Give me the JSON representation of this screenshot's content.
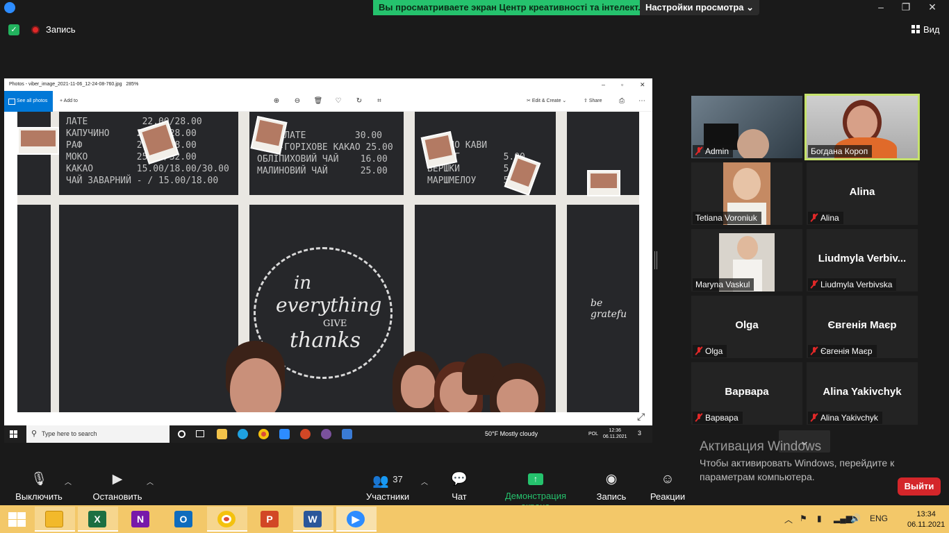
{
  "zoom": {
    "share_banner": "Вы просматриваете экран Центр креативності та інтелект...",
    "view_options": "Настройки просмотра",
    "recording_label": "Запись",
    "view_label": "Вид",
    "window_controls": [
      "–",
      "❐",
      "✕"
    ]
  },
  "photos_app": {
    "title": "Photos - viber_image_2021-11-06_12-24-08-760.jpg",
    "zoom_level": "285%",
    "see_all": "See all photos",
    "add_to": "Add to",
    "edit_create": "Edit & Create",
    "share": "Share",
    "board_left": "ЛАТЕ          22.00/28.00\nКАПУЧИНО     22.00/28.00\nРАФ          28.00/38.00\nМОКО         25.00/32.00\nКАКАО        15.00/18.00/30.00\nЧАЙ ЗАВАРНИЙ - / 15.00/18.00",
    "board_mid": "РІНЕ ЛАТЕ         30.00\nЗОВО-ГОРІХОВЕ КАКАО 25.00\nОБЛІПИХОВИЙ ЧАЙ    16.00\nМАЛИНОВИЙ ЧАЙ      25.00",
    "board_right": "ДАЙ ДО КАВИ\nТОПІНГ        5.00\nВЕРШКИ        5.00\nМАРШМЕЛОУ     5.00",
    "chalk_in": "in",
    "chalk_everything": "everything",
    "chalk_give": "GIVE",
    "chalk_thanks": "thanks",
    "chalk_grateful": "be gratefu"
  },
  "inner_taskbar": {
    "search_placeholder": "Type here to search",
    "weather": "50°F  Mostly cloudy",
    "lang": "POL",
    "time": "12:36",
    "date": "06.11.2021",
    "notif_count": "3"
  },
  "participants": [
    {
      "name": "Admin",
      "muted": true,
      "video": true
    },
    {
      "name": "Богдана Короп",
      "muted": false,
      "video": true,
      "active_speaker": true
    },
    {
      "name": "Tetiana Voroniuk",
      "muted": false,
      "video": true
    },
    {
      "name": "Alina",
      "display": "Alina",
      "muted": true,
      "video": false
    },
    {
      "name": "Maryna Vaskul",
      "muted": false,
      "video": true
    },
    {
      "name": "Liudmyla Verbivska",
      "display": "Liudmyla  Verbiv...",
      "muted": true,
      "video": false
    },
    {
      "name": "Olga",
      "display": "Olga",
      "muted": true,
      "video": false
    },
    {
      "name": "Євгенія Маєр",
      "display": "Євгенія Маєр",
      "muted": true,
      "video": false
    },
    {
      "name": "Варвара",
      "display": "Варвара",
      "muted": true,
      "video": false
    },
    {
      "name": "Alina Yakivchyk",
      "display": "Alina Yakivchyk",
      "muted": true,
      "video": false
    }
  ],
  "activation": {
    "title": "Активация Windows",
    "subtitle": "Чтобы активировать Windows, перейдите к параметрам компьютера."
  },
  "controls": {
    "mute": "Выключить звук",
    "stop_video": "Остановить видео",
    "participants": "Участники",
    "participants_count": "37",
    "chat": "Чат",
    "share_screen": "Демонстрация экрана",
    "record": "Запись",
    "reactions": "Реакции",
    "leave": "Выйти"
  },
  "taskbar": {
    "lang": "ENG",
    "time": "13:34",
    "date": "06.11.2021",
    "apps": [
      "file-explorer",
      "excel",
      "onenote",
      "outlook",
      "chrome",
      "powerpoint",
      "word",
      "zoom"
    ]
  },
  "colors": {
    "banner_green": "#25c26d",
    "leave_red": "#d4262a",
    "active_speaker": "#c6e36b",
    "taskbar": "#f3c869"
  }
}
